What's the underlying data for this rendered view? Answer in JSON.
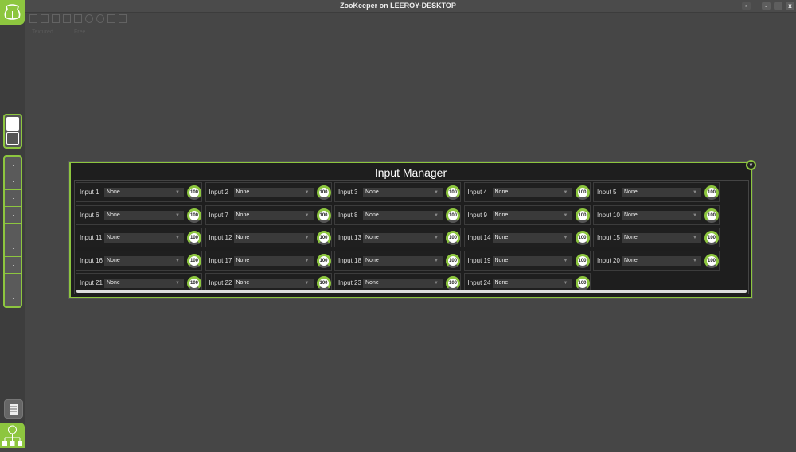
{
  "window": {
    "title": "ZooKeeper on LEEROY-DESKTOP",
    "min": "-",
    "max": "+",
    "close": "x"
  },
  "toolbar": {
    "view_mode": "Textured",
    "camera_mode": "Free"
  },
  "dialog": {
    "title": "Input Manager",
    "close": "×",
    "inputs": [
      {
        "label": "Input 1",
        "value": "None",
        "level": "100"
      },
      {
        "label": "Input 2",
        "value": "None",
        "level": "100"
      },
      {
        "label": "Input 3",
        "value": "None",
        "level": "100"
      },
      {
        "label": "Input 4",
        "value": "None",
        "level": "100"
      },
      {
        "label": "Input 5",
        "value": "None",
        "level": "100"
      },
      {
        "label": "Input 6",
        "value": "None",
        "level": "100"
      },
      {
        "label": "Input 7",
        "value": "None",
        "level": "100"
      },
      {
        "label": "Input 8",
        "value": "None",
        "level": "100"
      },
      {
        "label": "Input 9",
        "value": "None",
        "level": "100"
      },
      {
        "label": "Input 10",
        "value": "None",
        "level": "100"
      },
      {
        "label": "Input 11",
        "value": "None",
        "level": "100"
      },
      {
        "label": "Input 12",
        "value": "None",
        "level": "100"
      },
      {
        "label": "Input 13",
        "value": "None",
        "level": "100"
      },
      {
        "label": "Input 14",
        "value": "None",
        "level": "100"
      },
      {
        "label": "Input 15",
        "value": "None",
        "level": "100"
      },
      {
        "label": "Input 16",
        "value": "None",
        "level": "100"
      },
      {
        "label": "Input 17",
        "value": "None",
        "level": "100"
      },
      {
        "label": "Input 18",
        "value": "None",
        "level": "100"
      },
      {
        "label": "Input 19",
        "value": "None",
        "level": "100"
      },
      {
        "label": "Input 20",
        "value": "None",
        "level": "100"
      },
      {
        "label": "Input 21",
        "value": "None",
        "level": "100"
      },
      {
        "label": "Input 22",
        "value": "None",
        "level": "100"
      },
      {
        "label": "Input 23",
        "value": "None",
        "level": "100"
      },
      {
        "label": "Input 24",
        "value": "None",
        "level": "100"
      }
    ]
  },
  "colors": {
    "accent": "#8dc63f"
  }
}
